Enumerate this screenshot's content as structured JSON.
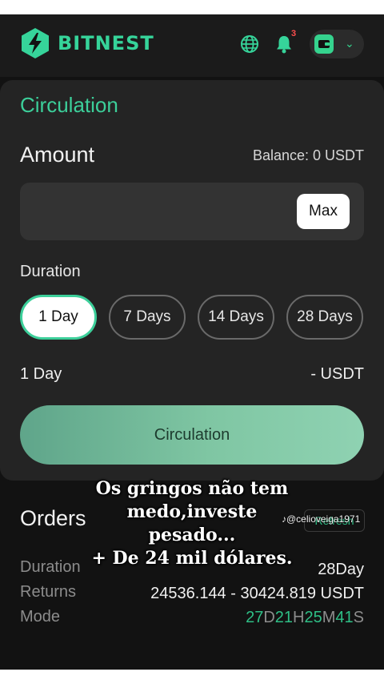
{
  "header": {
    "brand": "BITNEST",
    "notification_count": "3",
    "colors": {
      "accent": "#36d49a",
      "badge": "#ff4d4d"
    }
  },
  "circulation": {
    "title": "Circulation",
    "amount_label": "Amount",
    "balance_text": "Balance: 0 USDT",
    "max_label": "Max",
    "duration_label": "Duration",
    "durations": [
      "1 Day",
      "7 Days",
      "14 Days",
      "28 Days"
    ],
    "selected_duration": "1 Day",
    "summary_left": "1 Day",
    "summary_right": "- USDT",
    "button_label": "Circulation"
  },
  "orders": {
    "title": "Orders",
    "refresh_label": "Refresh",
    "rows": [
      {
        "label": "Duration",
        "value": "28Day"
      },
      {
        "label": "Returns",
        "value": "24536.144 - 30424.819 USDT"
      },
      {
        "label": "Mode",
        "value": ""
      }
    ],
    "mode_parts": [
      "27",
      "D",
      "21",
      "H",
      "25",
      "M",
      "41",
      "S"
    ]
  },
  "overlay": {
    "caption_lines": [
      "Os gringos não tem",
      "medo,investe",
      "pesado...",
      "+ De 24 mil dólares."
    ],
    "tiktok_handle": "@celioveiga1971"
  }
}
